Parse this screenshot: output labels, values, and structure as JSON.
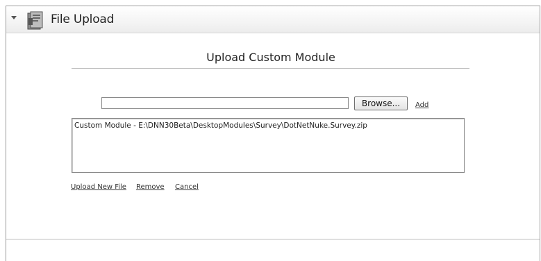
{
  "module": {
    "title": "File Upload"
  },
  "upload": {
    "heading": "Upload Custom Module",
    "file_path_value": "",
    "browse_label": "Browse...",
    "add_label": "Add",
    "files": [
      "Custom Module - E:\\DNN30Beta\\DesktopModules\\Survey\\DotNetNuke.Survey.zip"
    ],
    "upload_new_file_label": "Upload New File",
    "remove_label": "Remove",
    "cancel_label": "Cancel"
  },
  "icons": {
    "collapse": "chevron-down-icon",
    "module": "file-upload-module-icon"
  }
}
